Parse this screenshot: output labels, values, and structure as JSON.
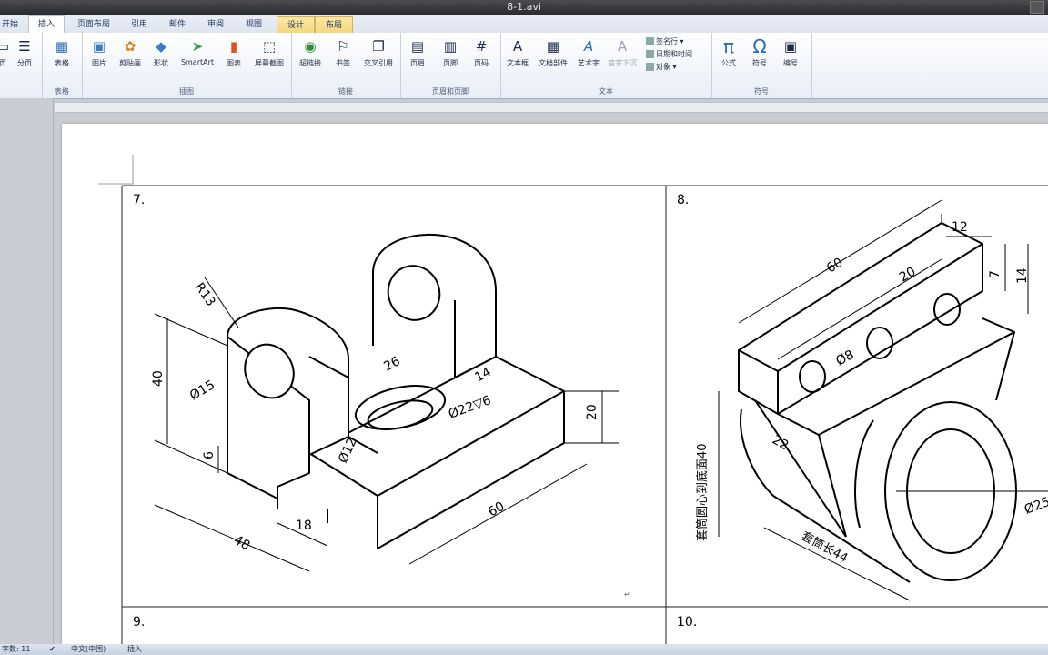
{
  "window": {
    "title": "8-1.avi"
  },
  "tabs": [
    {
      "label": "开始"
    },
    {
      "label": "插入"
    },
    {
      "label": "页面布局"
    },
    {
      "label": "引用"
    },
    {
      "label": "邮件"
    },
    {
      "label": "审阅"
    },
    {
      "label": "视图"
    },
    {
      "label": "设计"
    },
    {
      "label": "布局"
    }
  ],
  "ribbon": {
    "groups": {
      "pages_partial": "页",
      "pagebreak": "分页",
      "table_btn": "表格",
      "table_group": "表格",
      "illus": {
        "picture": "图片",
        "clipart": "剪贴画",
        "shapes": "形状",
        "smartart": "SmartArt",
        "chart": "图表",
        "screenshot": "屏幕截图",
        "group": "插图"
      },
      "links": {
        "hyperlink": "超链接",
        "bookmark": "书签",
        "crossref": "交叉引用",
        "group": "链接"
      },
      "hf": {
        "header": "页眉",
        "footer": "页脚",
        "pagenum": "页码",
        "group": "页眉和页脚"
      },
      "text": {
        "textbox": "文本框",
        "quickparts": "文档部件",
        "wordart": "艺术字",
        "dropcap": "首字下沉",
        "signature": "签名行 ▾",
        "datetime": "日期和时间",
        "object": "对象 ▾",
        "group": "文本"
      },
      "symbols": {
        "equation": "公式",
        "symbol": "符号",
        "number": "编号",
        "group": "符号"
      }
    }
  },
  "document": {
    "cells": {
      "c7": "7.",
      "c8": "8.",
      "c9": "9.",
      "c10": "10."
    },
    "fig7": {
      "r13": "R13",
      "d40": "40",
      "d15": "Ø15",
      "d26": "26",
      "d14": "14",
      "d22": "Ø22▽6",
      "d20": "20",
      "d12": "Ø12",
      "d6": "6",
      "d18": "18",
      "d48": "48",
      "d60": "60"
    },
    "fig8": {
      "d12": "12",
      "d60": "60",
      "d20": "20",
      "d7": "7",
      "d14": "14",
      "d8": "Ø8",
      "d22": "22",
      "hole40": "套筒圆心到底面40",
      "len44": "套筒长44",
      "d25": "Ø25"
    }
  },
  "status": {
    "words": "字数: 11",
    "lang": "中文(中国)",
    "mode": "插入"
  }
}
